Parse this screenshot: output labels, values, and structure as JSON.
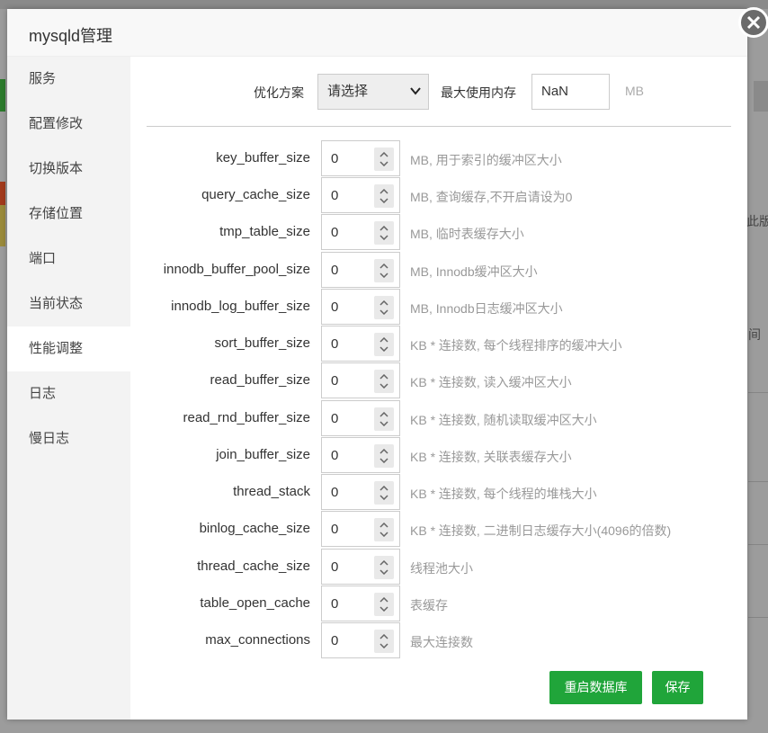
{
  "modal": {
    "title": "mysqld管理",
    "close_icon": "close-icon"
  },
  "sidebar": {
    "items": [
      {
        "label": "服务"
      },
      {
        "label": "配置修改"
      },
      {
        "label": "切换版本"
      },
      {
        "label": "存储位置"
      },
      {
        "label": "端口"
      },
      {
        "label": "当前状态"
      },
      {
        "label": "性能调整",
        "active": true
      },
      {
        "label": "日志"
      },
      {
        "label": "慢日志"
      }
    ]
  },
  "top": {
    "scheme_label": "优化方案",
    "scheme_value": "请选择",
    "mem_label": "最大使用内存",
    "mem_value": "NaN",
    "mem_unit": "MB"
  },
  "params": [
    {
      "name": "key_buffer_size",
      "value": "0",
      "desc": "MB, 用于索引的缓冲区大小"
    },
    {
      "name": "query_cache_size",
      "value": "0",
      "desc": "MB, 查询缓存,不开启请设为0"
    },
    {
      "name": "tmp_table_size",
      "value": "0",
      "desc": "MB, 临时表缓存大小"
    },
    {
      "name": "innodb_buffer_pool_size",
      "value": "0",
      "desc": "MB, Innodb缓冲区大小"
    },
    {
      "name": "innodb_log_buffer_size",
      "value": "0",
      "desc": "MB, Innodb日志缓冲区大小"
    },
    {
      "name": "sort_buffer_size",
      "value": "0",
      "desc": "KB * 连接数, 每个线程排序的缓冲大小"
    },
    {
      "name": "read_buffer_size",
      "value": "0",
      "desc": "KB * 连接数, 读入缓冲区大小"
    },
    {
      "name": "read_rnd_buffer_size",
      "value": "0",
      "desc": "KB * 连接数, 随机读取缓冲区大小"
    },
    {
      "name": "join_buffer_size",
      "value": "0",
      "desc": "KB * 连接数, 关联表缓存大小"
    },
    {
      "name": "thread_stack",
      "value": "0",
      "desc": "KB * 连接数, 每个线程的堆栈大小"
    },
    {
      "name": "binlog_cache_size",
      "value": "0",
      "desc": "KB * 连接数, 二进制日志缓存大小(4096的倍数)"
    },
    {
      "name": "thread_cache_size",
      "value": "0",
      "desc": "线程池大小"
    },
    {
      "name": "table_open_cache",
      "value": "0",
      "desc": "表缓存"
    },
    {
      "name": "max_connections",
      "value": "0",
      "desc": "最大连接数"
    }
  ],
  "buttons": {
    "restart": "重启数据库",
    "save": "保存"
  },
  "background": {
    "partial_text_1": "此版本",
    "partial_text_2": "间"
  },
  "colors": {
    "accent": "#20a53a",
    "overlay": "#9c9c9c"
  }
}
